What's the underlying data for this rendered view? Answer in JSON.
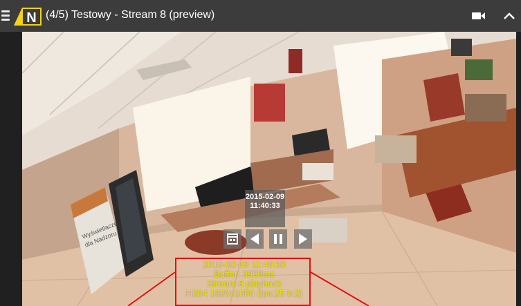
{
  "header": {
    "title": "(4/5) Testowy - Stream 8 (preview)",
    "logo_letter": "N"
  },
  "icons": {
    "menu": "hamburger-icon",
    "camera": "video-camera-icon",
    "collapse": "chevron-up-icon",
    "calendar": "calendar-icon",
    "prev": "play-backward-icon",
    "pause": "pause-icon",
    "next": "play-forward-icon"
  },
  "colors": {
    "topbar": "#3c3c3c",
    "overlay_text": "#e6e600",
    "overlay_border": "#e01010",
    "logo_yellow": "#f2d21b"
  },
  "playback": {
    "date": "2015-02-09",
    "time": "11:40:33"
  },
  "overlay": {
    "datetime": "2015-02-09 11:40:33",
    "buffer": "Buffer: 3958ms",
    "stream": "Stream 8 playback",
    "codec": "H264 1920x1080 (fps:25 b:2)"
  },
  "video_scene": {
    "banner_line1": "Wyświetlacze",
    "banner_line2": "dla Nadzoru"
  }
}
